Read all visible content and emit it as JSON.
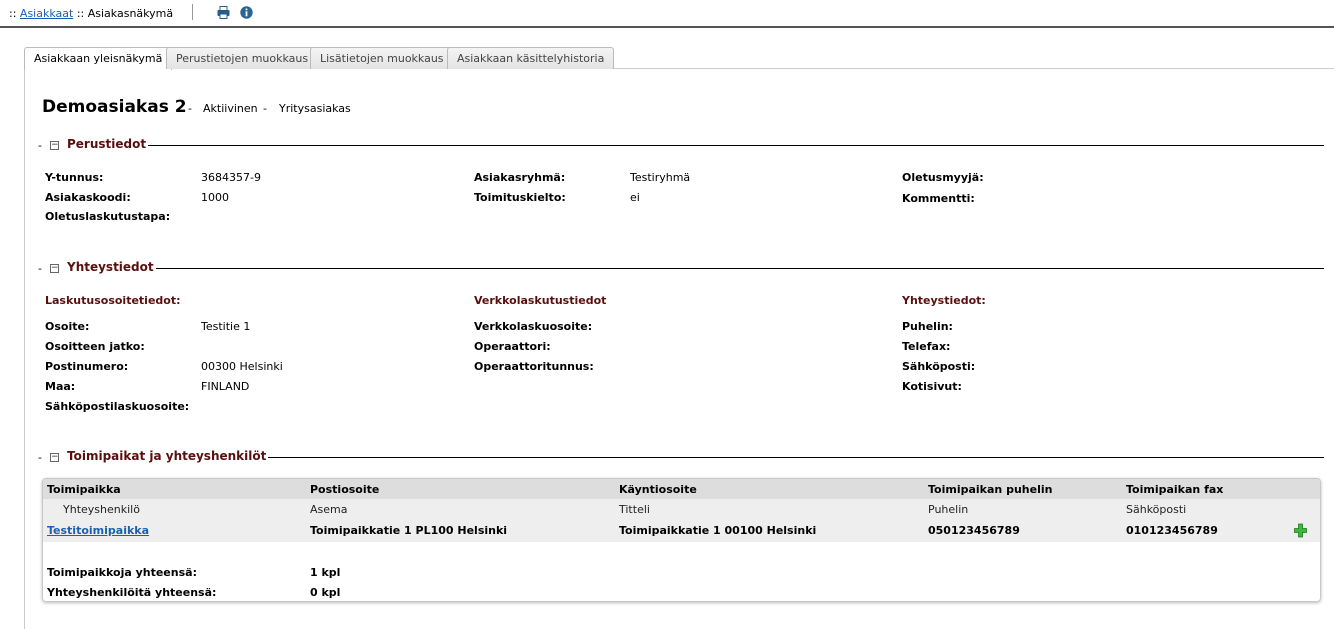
{
  "breadcrumb": {
    "prefix": "::",
    "link": "Asiakkaat",
    "prefix2": "::",
    "current": "Asiakasnäkymä"
  },
  "toolbar": {
    "print_icon": "printer-icon",
    "info_icon": "info-icon"
  },
  "tabs": [
    {
      "label": "Asiakkaan yleisnäkymä",
      "active": true
    },
    {
      "label": "Perustietojen muokkaus"
    },
    {
      "label": "Lisätietojen muokkaus"
    },
    {
      "label": "Asiakkaan käsittelyhistoria"
    }
  ],
  "customer": {
    "name": "Demoasiakas 2",
    "sep": "-",
    "status": "Aktiivinen",
    "type": "Yritysasiakas"
  },
  "sections": {
    "basic": {
      "title": "Perustiedot",
      "fields": {
        "ytunnus_label": "Y-tunnus:",
        "ytunnus": "3684357-9",
        "code_label": "Asiakaskoodi:",
        "code": "1000",
        "billing_label": "Oletuslaskutustapa:",
        "group_label": "Asiakasryhmä:",
        "group": "Testiryhmä",
        "ban_label": "Toimituskielto:",
        "ban": "ei",
        "seller_label": "Oletusmyyjä:",
        "comment_label": "Kommentti:"
      }
    },
    "contact": {
      "title": "Yhteystiedot",
      "billing_head": "Laskutusosoitetiedot:",
      "address_label": "Osoite:",
      "address": "Testitie 1",
      "address2_label": "Osoitteen jatko:",
      "postal_label": "Postinumero:",
      "postal": "00300 Helsinki",
      "country_label": "Maa:",
      "country": "FINLAND",
      "email_invoice_label": "Sähköpostilaskuosoite:",
      "einvoice_head": "Verkkolaskutustiedot",
      "einvoice_addr_label": "Verkkolaskuosoite:",
      "operator_label": "Operaattori:",
      "operator_id_label": "Operaattoritunnus:",
      "contact_head": "Yhteystiedot:",
      "phone_label": "Puhelin:",
      "fax_label": "Telefax:",
      "email_label": "Sähköposti:",
      "web_label": "Kotisivut:"
    },
    "locations": {
      "title": "Toimipaikat ja yhteyshenkilöt",
      "headers": [
        "Toimipaikka",
        "Postiosoite",
        "Käyntiosoite",
        "Toimipaikan puhelin",
        "Toimipaikan fax"
      ],
      "subheaders": [
        "Yhteyshenkilö",
        "Asema",
        "Titteli",
        "Puhelin",
        "Sähköposti"
      ],
      "rows": [
        [
          "Testitoimipaikka",
          "Toimipaikkatie 1 PL100 Helsinki",
          "Toimipaikkatie 1 00100 Helsinki",
          "050123456789",
          "010123456789"
        ]
      ],
      "totals": [
        {
          "label": "Toimipaikkoja yhteensä:",
          "value": "1 kpl"
        },
        {
          "label": "Yhteyshenkilöitä yhteensä:",
          "value": "0 kpl"
        }
      ]
    }
  }
}
